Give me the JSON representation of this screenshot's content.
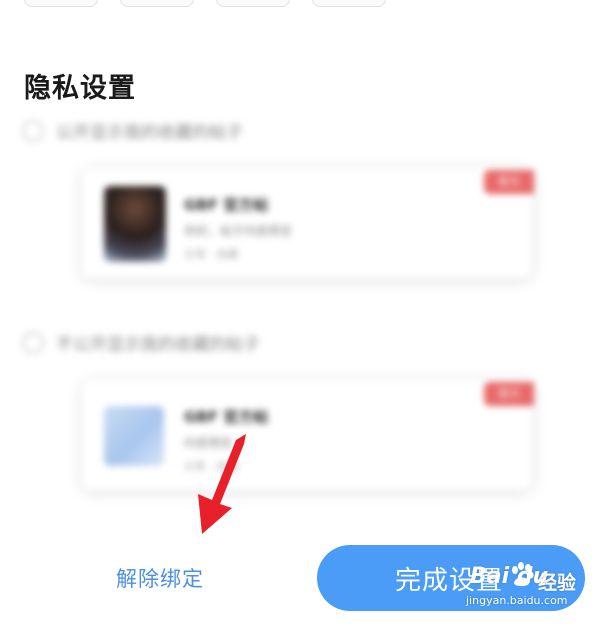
{
  "section": {
    "title": "隐私设置"
  },
  "options": [
    {
      "label": "公开显示我的收藏的帖子",
      "card": {
        "title": "GBF 官方帖",
        "desc": "你好，帖子内容预览",
        "meta": "分享 · 收藏",
        "tag": "官方"
      }
    },
    {
      "label": "不公开显示我的收藏的帖子",
      "card": {
        "title": "GBF 官方帖",
        "desc": "内容预览",
        "meta": "分享 · 收藏",
        "tag": "官方"
      }
    }
  ],
  "footer": {
    "unbind_label": "解除绑定",
    "finish_label": "完成设置"
  },
  "watermark": {
    "brand": "Bai du",
    "product": "经验",
    "url": "jingyan.baidu.com"
  },
  "colors": {
    "accent": "#4a9cf6",
    "link": "#4a90e2",
    "arrow": "#e8202a",
    "tag": "#e86a6a"
  }
}
